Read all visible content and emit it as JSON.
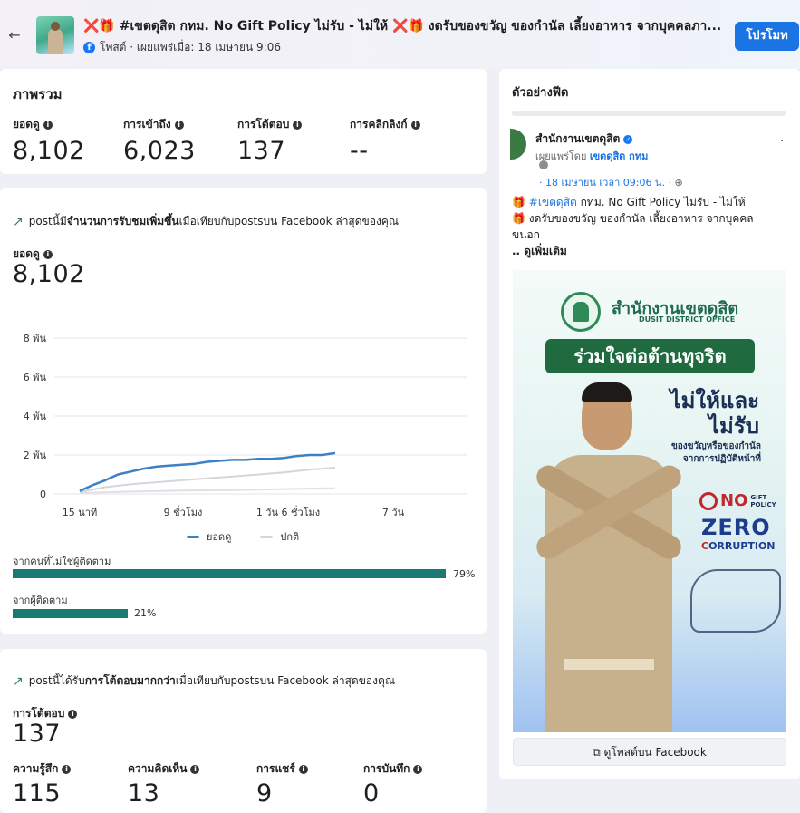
{
  "header": {
    "title": "❌🎁 #เขตดุสิต กทม. No Gift Policy ไม่รับ - ไม่ให้ ❌🎁 งดรับของขวัญ ของกำนัล เลี้ยงอาหาร จากบุคคลภา...",
    "meta": "โพสต์ · เผยแพร่เมื่อ: 18 เมษายน 9:06",
    "promote_label": "โปรโมท",
    "back_icon": "back-arrow-icon"
  },
  "overview": {
    "title": "ภาพรวม",
    "metrics": [
      {
        "label": "ยอดดู",
        "value": "8,102"
      },
      {
        "label": "การเข้าถึง",
        "value": "6,023"
      },
      {
        "label": "การโต้ตอบ",
        "value": "137"
      },
      {
        "label": "การคลิกลิงก์",
        "value": "--"
      }
    ]
  },
  "reach": {
    "headline_pre": "postนี้มี",
    "headline_bold": "จำนวนการรับชมเพิ่มขึ้น",
    "headline_post": "เมื่อเทียบกับpostsบน Facebook ล่าสุดของคุณ",
    "views_label": "ยอดดู",
    "views_value": "8,102",
    "legend": [
      "ยอดดู",
      "ปกติ"
    ],
    "breakdown": [
      {
        "label": "จากคนที่ไม่ใช่ผู้ติดตาม",
        "percent": 79,
        "pct_label": "79%"
      },
      {
        "label": "จากผู้ติดตาม",
        "percent": 21,
        "pct_label": "21%"
      }
    ]
  },
  "interact": {
    "headline_pre": "postนี้ได้รับ",
    "headline_bold": "การโต้ตอบมากกว่า",
    "headline_post": "เมื่อเทียบกับpostsบน Facebook ล่าสุดของคุณ",
    "total_label": "การโต้ตอบ",
    "total_value": "137",
    "metrics": [
      {
        "label": "ความรู้สึก",
        "value": "115"
      },
      {
        "label": "ความคิดเห็น",
        "value": "13"
      },
      {
        "label": "การแชร์",
        "value": "9"
      },
      {
        "label": "การบันทึก",
        "value": "0"
      }
    ]
  },
  "preview": {
    "title": "ตัวอย่างฟีด",
    "page_name": "สำนักงานเขตดุสิต",
    "published_by_pre": "เผยแพร่โดย",
    "published_by_name": "เขตดุสิต กทม",
    "date": "· 18 เมษายน เวลา 09:06 น. · ",
    "line1_tag": "#เขตดุสิต",
    "line1_rest": " กทม. No Gift Policy ไม่รับ - ไม่ให้",
    "line2": " งดรับของขวัญ ของกำนัล เลี้ยงอาหาร จากบุคคล",
    "line3": "ขนอก",
    "see_more": ".. ดูเพิ่มเติม",
    "image": {
      "office_th": "สำนักงานเขตดุสิต",
      "office_en": "DUSIT DISTRICT OFFICE",
      "banner": "ร่วมใจต่อต้านทุจริต",
      "headline_1": "ไม่ให้และ",
      "headline_2": "ไม่รับ",
      "sub_1": "ของขวัญหรือของกำนัล",
      "sub_2": "จากการปฏิบัติหน้าที่",
      "no": "NO",
      "gift": "GIFT",
      "policy": "POLICY",
      "zero": "ZERO",
      "corruption_c": "C",
      "corruption_rest": "ORRUPTION"
    },
    "view_on_fb": "ดูโพสต์บน Facebook"
  },
  "chart_data": {
    "type": "line",
    "x_ticks": [
      "15 นาที",
      "9 ชั่วโมง",
      "1 วัน 6 ชั่วโมง",
      "7 วัน"
    ],
    "y_ticks": [
      "0",
      "2 พัน",
      "4 พัน",
      "6 พัน",
      "8 พัน"
    ],
    "ylim": [
      0,
      8000
    ],
    "grid": true,
    "legend_position": "bottom",
    "series": [
      {
        "name": "ยอดดู",
        "color": "#3b82c4",
        "x_frac": [
          0.0,
          0.05,
          0.1,
          0.15,
          0.2,
          0.25,
          0.3,
          0.35,
          0.4,
          0.45,
          0.5,
          0.55,
          0.6,
          0.65,
          0.7,
          0.75,
          0.8,
          0.85,
          0.9,
          0.95,
          1.0
        ],
        "values": [
          150,
          450,
          700,
          1000,
          1150,
          1300,
          1400,
          1450,
          1500,
          1550,
          1650,
          1700,
          1750,
          1750,
          1800,
          1800,
          1850,
          1950,
          2000,
          2000,
          2100
        ]
      },
      {
        "name": "ปกติ",
        "color": "#d3d6db",
        "x_frac": [
          0.0,
          0.1,
          0.2,
          0.3,
          0.4,
          0.5,
          0.6,
          0.7,
          0.8,
          0.9,
          1.0
        ],
        "values": [
          100,
          350,
          500,
          600,
          700,
          800,
          900,
          1000,
          1100,
          1250,
          1350
        ]
      },
      {
        "name": "ปกติ-low",
        "color": "#dfe1e5",
        "x_frac": [
          0.0,
          0.2,
          0.4,
          0.6,
          0.8,
          1.0
        ],
        "values": [
          50,
          120,
          170,
          200,
          250,
          300
        ]
      }
    ]
  },
  "colors": {
    "accent": "#1b74e4",
    "bar": "#1a7a73",
    "views_line": "#3b82c4",
    "normal_line": "#d3d6db"
  }
}
